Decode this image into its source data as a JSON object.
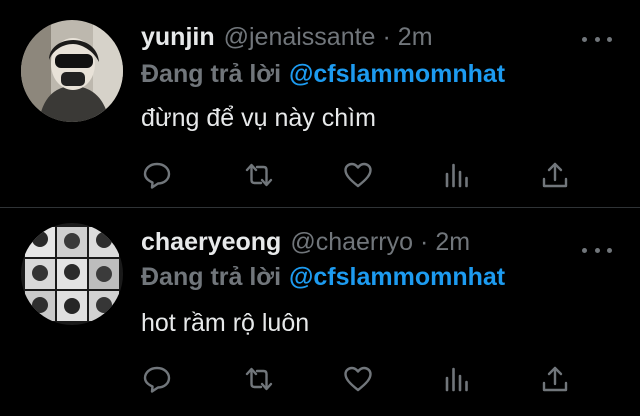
{
  "tweets": [
    {
      "display_name": "yunjin",
      "handle": "@jenaissante",
      "separator": "·",
      "time": "2m",
      "replying_prefix": "Đang trả lời",
      "replying_to": "@cfslammomnhat",
      "text": "đừng để vụ này chìm"
    },
    {
      "display_name": "chaeryeong",
      "handle": "@chaerryo",
      "separator": "·",
      "time": "2m",
      "replying_prefix": "Đang trả lời",
      "replying_to": "@cfslammomnhat",
      "text": "hot rầm rộ luôn"
    }
  ],
  "icons": {
    "reply": "reply-icon",
    "retweet": "retweet-icon",
    "like": "heart-icon",
    "stats": "stats-icon",
    "share": "share-icon",
    "more": "more-icon"
  },
  "colors": {
    "background": "#000000",
    "text": "#e7e9ea",
    "muted": "#71767b",
    "accent": "#1d9bf0",
    "divider": "#2f3336"
  }
}
